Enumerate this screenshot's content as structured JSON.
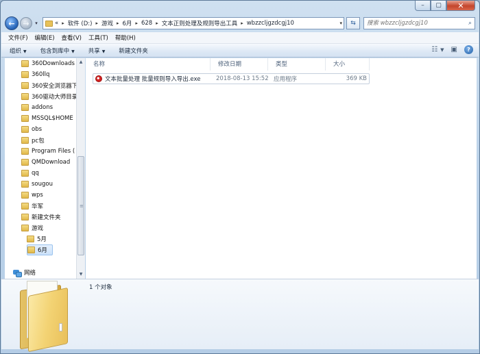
{
  "window": {
    "minimize_icon": "minimize-icon",
    "maximize_icon": "maximize-icon",
    "close_icon": "close-icon"
  },
  "address": {
    "overflow": "«",
    "crumbs": [
      "软件 (D:)",
      "游戏",
      "6月",
      "628",
      "文本正则处理及规则导出工具",
      "wbzzcljgzdcgj10"
    ]
  },
  "search": {
    "placeholder": "搜索 wbzzcljgzdcgj10"
  },
  "menu": [
    "文件(F)",
    "编辑(E)",
    "查看(V)",
    "工具(T)",
    "帮助(H)"
  ],
  "commands": {
    "organize": "组织",
    "include_library": "包含到库中",
    "share": "共享",
    "new_folder": "新建文件夹"
  },
  "tree": {
    "folders": [
      "360Downloads",
      "360llq",
      "360安全浏览器下",
      "360驱动大师目录",
      "addons",
      "MSSQL$HOME",
      "obs",
      "pc包",
      "Program Files (",
      "QMDownload",
      "qq",
      "sougou",
      "wps",
      "华军",
      "新建文件夹",
      "游戏"
    ],
    "subfolders": [
      "5月",
      "6月"
    ],
    "selected": "6月",
    "network": "网络"
  },
  "columns": {
    "name": "名称",
    "modified": "修改日期",
    "type": "类型",
    "size": "大小"
  },
  "files": [
    {
      "name": "文本批量处理 批量规则导入导出.exe",
      "modified": "2018-08-13 15:52",
      "type": "应用程序",
      "size": "369 KB"
    }
  ],
  "details": {
    "count": "1 个对象"
  },
  "colors": {
    "frame": "#b9d0e8",
    "selection": "#cce2fa",
    "folder": "#e8c25a"
  }
}
